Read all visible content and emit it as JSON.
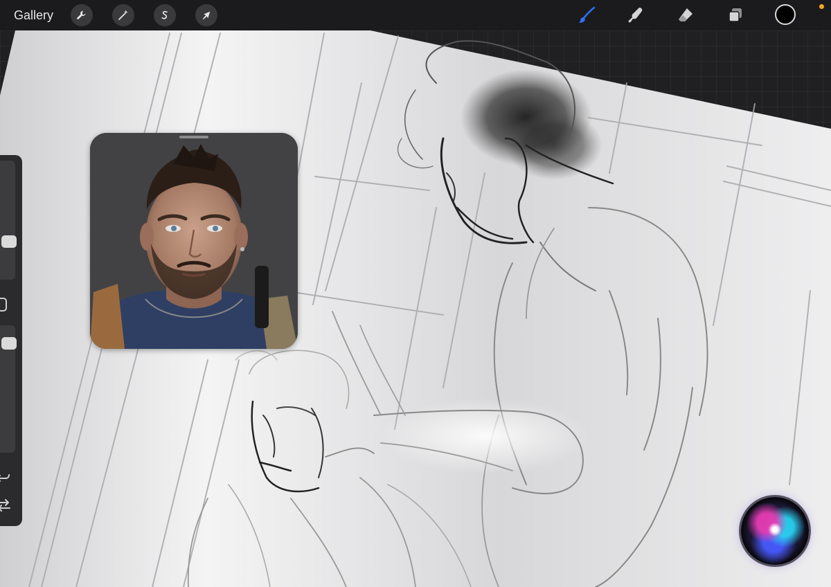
{
  "toolbar": {
    "gallery_label": "Gallery",
    "left_tools": [
      {
        "name": "actions",
        "icon": "wrench-icon"
      },
      {
        "name": "adjustments",
        "icon": "magic-wand-icon"
      },
      {
        "name": "selection",
        "icon": "selection-s-icon"
      },
      {
        "name": "transform",
        "icon": "arrow-cursor-icon"
      }
    ],
    "right_tools": [
      {
        "name": "paint",
        "icon": "brush-icon",
        "active": true
      },
      {
        "name": "smudge",
        "icon": "smudge-finger-icon"
      },
      {
        "name": "erase",
        "icon": "eraser-icon"
      },
      {
        "name": "layers",
        "icon": "layers-icon"
      }
    ],
    "active_color": "#000000",
    "accent_color": "#2f6ff7",
    "status_dot_color": "#f5a524"
  },
  "sidebar": {
    "brush_size_level": 0.3,
    "opacity_level": 0.1,
    "icons": [
      "modify-square-icon",
      "undo-icon",
      "redo-icon"
    ]
  },
  "reference": {
    "icon": "reference-photo"
  },
  "siri": {
    "icon": "siri-orb-icon"
  }
}
